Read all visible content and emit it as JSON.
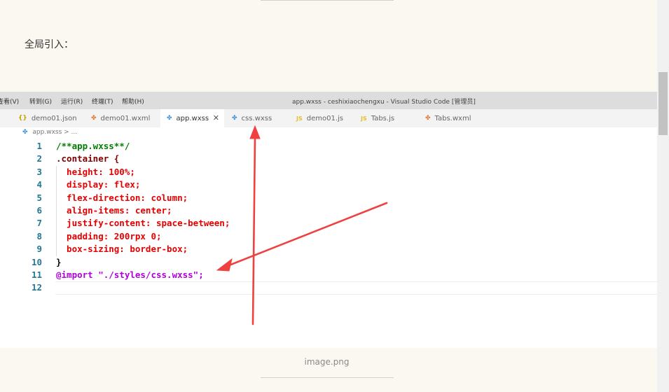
{
  "intro": "全局引入：",
  "caption": "image.png",
  "menubar": {
    "items": [
      "查看(V)",
      "转到(G)",
      "运行(R)",
      "终端(T)",
      "帮助(H)"
    ],
    "window_title": "app.wxss - ceshixiaochengxu - Visual Studio Code [管理员]"
  },
  "tabs": [
    {
      "label": "demo01.json",
      "icon": "json-braces-icon"
    },
    {
      "label": "demo01.wxml",
      "icon": "wxml-file-icon"
    },
    {
      "label": "app.wxss",
      "icon": "wxss-file-icon",
      "active": true
    },
    {
      "label": "css.wxss",
      "icon": "wxss-file-icon"
    },
    {
      "label": "demo01.js",
      "icon": "js-file-icon"
    },
    {
      "label": "Tabs.js",
      "icon": "js-file-icon"
    },
    {
      "label": "Tabs.wxml",
      "icon": "wxml-file-icon"
    }
  ],
  "breadcrumb": "app.wxss > ...",
  "code_lines": [
    {
      "n": "1",
      "text": "/**app.wxss**/"
    },
    {
      "n": "2",
      "text": ".container {"
    },
    {
      "n": "3",
      "text": "  height: 100%;"
    },
    {
      "n": "4",
      "text": "  display: flex;"
    },
    {
      "n": "5",
      "text": "  flex-direction: column;"
    },
    {
      "n": "6",
      "text": "  align-items: center;"
    },
    {
      "n": "7",
      "text": "  justify-content: space-between;"
    },
    {
      "n": "8",
      "text": "  padding: 200rpx 0;"
    },
    {
      "n": "9",
      "text": "  box-sizing: border-box;"
    },
    {
      "n": "10",
      "text": "}"
    },
    {
      "n": "11",
      "text": "@import \"./styles/css.wxss\";"
    },
    {
      "n": "12",
      "text": ""
    }
  ],
  "colors": {
    "page_bg": "#fbf8f2",
    "arrow": "#f04040",
    "comment": "#008000",
    "property": "#e50000",
    "value": "#0451a5",
    "number": "#098658",
    "at_rule": "#af00db",
    "string": "#a31515"
  }
}
